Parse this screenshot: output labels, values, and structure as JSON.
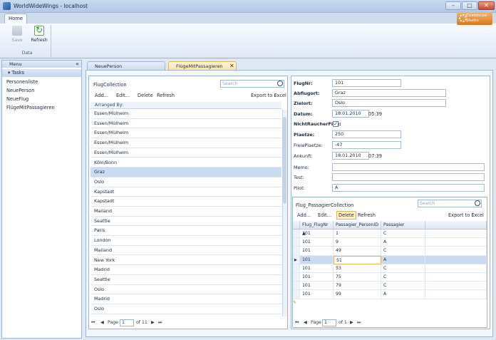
{
  "window": {
    "title": "WorldWideWings - localhost"
  },
  "ribbon": {
    "tab": "Home",
    "buttons": [
      {
        "label": "Save",
        "icon": "save-icon"
      },
      {
        "label": "Refresh",
        "icon": "refresh-icon"
      }
    ],
    "group_label": "Data"
  },
  "logo_text": "Customize Studio",
  "sidebar": {
    "menu_label": "Menu",
    "tasks_label": "Tasks",
    "items": [
      "Personenliste",
      "NeuePerson",
      "NeueFlug",
      "FlügeMitPassagieren"
    ]
  },
  "doc_tabs": [
    "NeuePerson",
    "FlügeMitPassagieren"
  ],
  "left": {
    "title": "FlugCollection",
    "search_placeholder": "Search",
    "toolbar": {
      "add": "Add...",
      "edit": "Edit...",
      "delete": "Delete",
      "refresh": "Refresh",
      "export": "Export to Excel"
    },
    "arranged_by": "Arranged By:",
    "rows": [
      "Essen/Mülheim",
      "Essen/Mülheim",
      "Essen/Mülheim",
      "Essen/Mülheim",
      "Essen/Mülheim",
      "Köln/Bonn",
      "Graz",
      "Oslo",
      "Kapstadt",
      "Kapstadt",
      "Mailand",
      "Seattle",
      "Paris",
      "London",
      "Mailand",
      "New York",
      "Madrid",
      "Seattle",
      "Oslo",
      "Madrid",
      "Oslo"
    ],
    "selected_index": 6,
    "pager": {
      "page_label": "Page",
      "page": "1",
      "of": "of 11"
    }
  },
  "detail": {
    "fields": [
      {
        "label": "FlugNr:",
        "value": "101",
        "bold": true
      },
      {
        "label": "Abflugort:",
        "value": "Graz",
        "bold": true
      },
      {
        "label": "Zielort:",
        "value": "Oslo",
        "bold": true
      },
      {
        "label": "Datum:",
        "value": "18.01.2010",
        "time": "05:39",
        "bold": true
      },
      {
        "label": "NichtRaucherFlug:",
        "value": "✓",
        "bold": true
      },
      {
        "label": "Plaetze:",
        "value": "250",
        "bold": true
      },
      {
        "label": "FreiePlaetze:",
        "value": "-47",
        "bold": false
      },
      {
        "label": "Ankunft:",
        "value": "18.01.2010",
        "time": "07:39",
        "bold": false
      },
      {
        "label": "Memo:",
        "value": "",
        "bold": false
      },
      {
        "label": "Test:",
        "value": "",
        "bold": false
      },
      {
        "label": "Pilot:",
        "value": "A",
        "bold": false
      }
    ]
  },
  "sub": {
    "title": "Flug_PassagierCollection",
    "search_placeholder": "Search",
    "toolbar": {
      "add": "Add...",
      "edit": "Edit...",
      "delete": "Delete",
      "refresh": "Refresh",
      "export": "Export to Excel"
    },
    "columns": [
      "Flug_FlugNr",
      "Passagier_PersonID",
      "Passagier"
    ],
    "rows": [
      [
        "101",
        "1",
        "C"
      ],
      [
        "101",
        "9",
        "A"
      ],
      [
        "101",
        "49",
        "C"
      ],
      [
        "101",
        "51",
        "A"
      ],
      [
        "101",
        "53",
        "C"
      ],
      [
        "101",
        "75",
        "C"
      ],
      [
        "101",
        "79",
        "C"
      ],
      [
        "101",
        "99",
        "A"
      ]
    ],
    "selected_index": 3,
    "pager": {
      "page_label": "Page",
      "page": "1",
      "of": "of 1"
    }
  }
}
